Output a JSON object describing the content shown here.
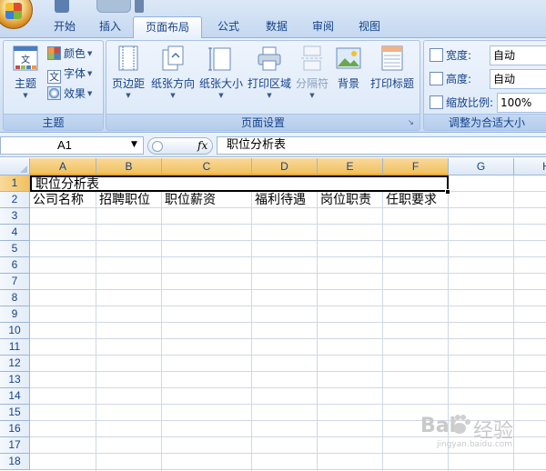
{
  "ribbon": {
    "tabs": [
      "开始",
      "插入",
      "页面布局",
      "公式",
      "数据",
      "审阅",
      "视图"
    ],
    "active_tab": "页面布局",
    "groups": {
      "theme": {
        "label": "主题",
        "main_button": "主题",
        "colors": "颜色",
        "fonts": "字体",
        "effects": "效果"
      },
      "page_setup": {
        "label": "页面设置",
        "margins": "页边距",
        "orientation": "纸张方向",
        "size": "纸张大小",
        "print_area": "打印区域",
        "breaks": "分隔符",
        "background": "背景",
        "print_titles": "打印标题"
      },
      "scale_to_fit": {
        "label": "调整为合适大小",
        "width_label": "宽度:",
        "width_value": "自动",
        "height_label": "高度:",
        "height_value": "自动",
        "scale_label": "缩放比例:",
        "scale_value": "100%"
      }
    }
  },
  "formula_bar": {
    "name_box": "A1",
    "fx_label": "fx",
    "content": "职位分析表"
  },
  "sheet": {
    "columns": [
      "A",
      "B",
      "C",
      "D",
      "E",
      "F",
      "G",
      "H"
    ],
    "rows": [
      "1",
      "2",
      "3",
      "4",
      "5",
      "6",
      "7",
      "8",
      "9",
      "10",
      "11",
      "12",
      "13",
      "14",
      "15",
      "16",
      "17",
      "18"
    ],
    "title_cell": "职位分析表",
    "row2": [
      "公司名称",
      "招聘职位",
      "职位薪资",
      "福利待遇",
      "岗位职责",
      "任职要求"
    ]
  },
  "watermark": {
    "brand_left": "Bai",
    "brand_right": "经验",
    "url": "jingyan.baidu.com"
  },
  "colors": {
    "accent": "#15428b",
    "selected_header": "#f1c15f",
    "grid_line": "#d0d7e5"
  }
}
